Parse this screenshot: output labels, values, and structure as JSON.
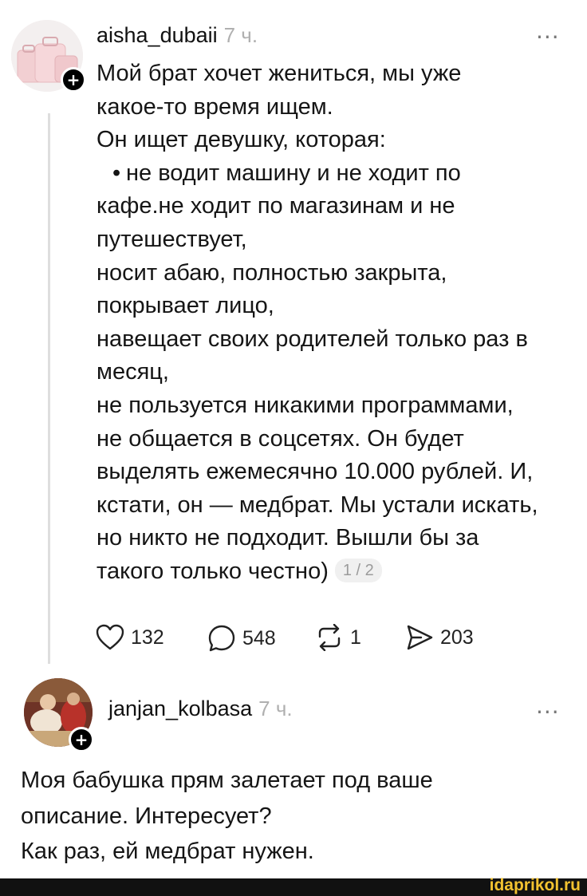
{
  "post1": {
    "username": "aisha_dubaii",
    "time": "7 ч.",
    "more": "...",
    "follow_icon": "plus",
    "lines": [
      "Мой брат хочет жениться, мы уже",
      "какое-то время ищем.",
      "Он ищет девушку, которая:"
    ],
    "bullet": "•",
    "bullet_text": "не водит машину и не ходит по",
    "lines_after": [
      "кафе.не ходит по магазинам и не",
      "путешествует,",
      "носит абаю, полностью закрыта,",
      "покрывает лицо,",
      "навещает своих родителей только раз в",
      "месяц,",
      "не пользуется никакими программами,",
      "не общается в соцсетях. Он будет",
      "выделять ежемесячно 10.000 рублей. И,",
      "кстати, он — медбрат. Мы устали искать,",
      "но никто не подходит. Вышли бы за"
    ],
    "last_line": "такого только честно)",
    "pager": "1 / 2",
    "actions": {
      "likes": "132",
      "comments": "548",
      "reposts": "1",
      "shares": "203"
    }
  },
  "post2": {
    "username": "janjan_kolbasa",
    "time": "7 ч.",
    "more": "...",
    "lines": [
      "Моя бабушка прям залетает под ваше",
      "описание. Интересует?",
      "Как раз, ей медбрат нужен."
    ]
  },
  "watermark": "idaprikol.ru",
  "colors": {
    "watermark": "#f2c230",
    "footer": "#111111",
    "muted": "#b0b0b0"
  }
}
